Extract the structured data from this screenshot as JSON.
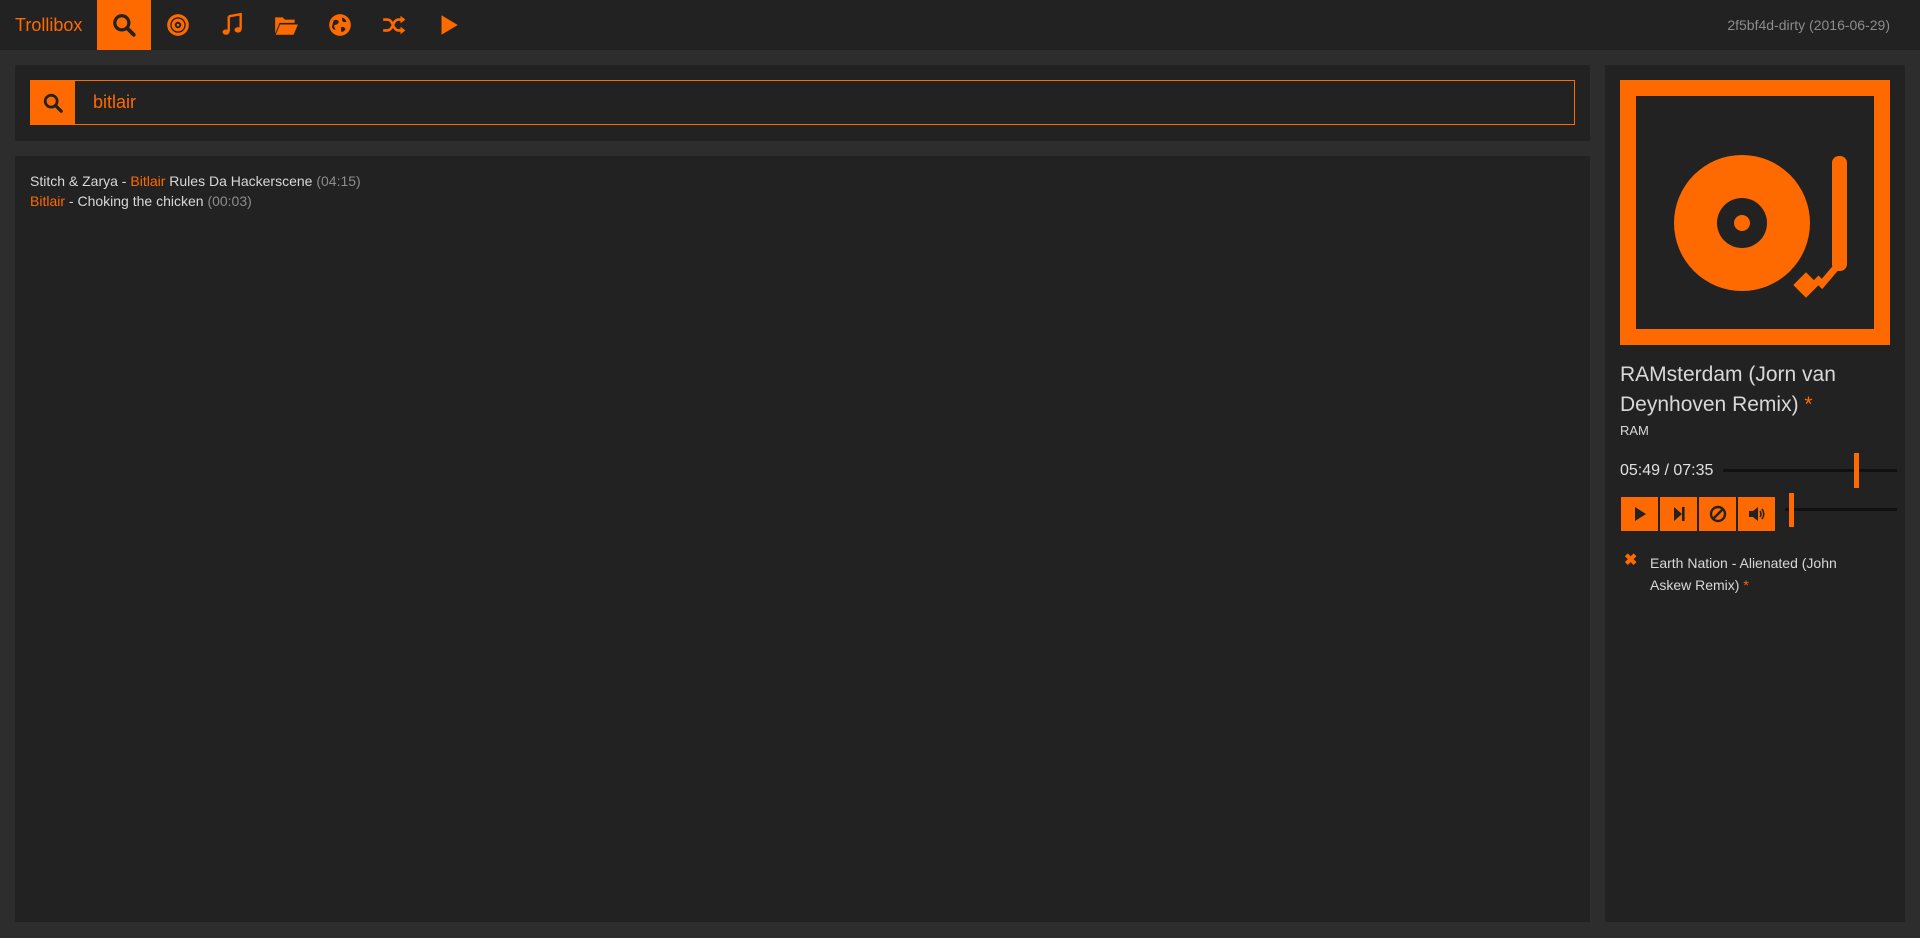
{
  "nav": {
    "brand": "Trollibox",
    "items": [
      {
        "icon": "search-icon",
        "active": true
      },
      {
        "icon": "disc-icon",
        "active": false
      },
      {
        "icon": "music-note-icon",
        "active": false
      },
      {
        "icon": "folder-open-icon",
        "active": false
      },
      {
        "icon": "globe-icon",
        "active": false
      },
      {
        "icon": "shuffle-icon",
        "active": false
      },
      {
        "icon": "play-icon",
        "active": false
      }
    ],
    "version": "2f5bf4d-dirty (2016-06-29)"
  },
  "search": {
    "value": "bitlair",
    "placeholder": ""
  },
  "results": [
    {
      "artist_pre": "Stitch & Zarya",
      "sep": " - ",
      "title_hl": "Bitlair",
      "title_rest": " Rules Da Hackerscene",
      "duration": "(04:15)"
    },
    {
      "artist_hl": "Bitlair",
      "sep": " - ",
      "title_rest": "Choking the chicken",
      "duration": "(00:03)"
    }
  ],
  "now_playing": {
    "title": "RAMsterdam (Jorn van Deynhoven Remix)",
    "star": "*",
    "artist": "RAM",
    "time": "05:49 / 07:35",
    "progress": 0.7667,
    "volume": 0.05,
    "controls": [
      "play-icon",
      "skip-next-icon",
      "ban-icon",
      "volume-icon"
    ]
  },
  "queue": [
    {
      "text": "Earth Nation - Alienated (John Askew Remix)",
      "star": "*"
    }
  ],
  "colors": {
    "accent": "#ff6a00",
    "panel": "#222222",
    "background": "#2d2d2d"
  }
}
